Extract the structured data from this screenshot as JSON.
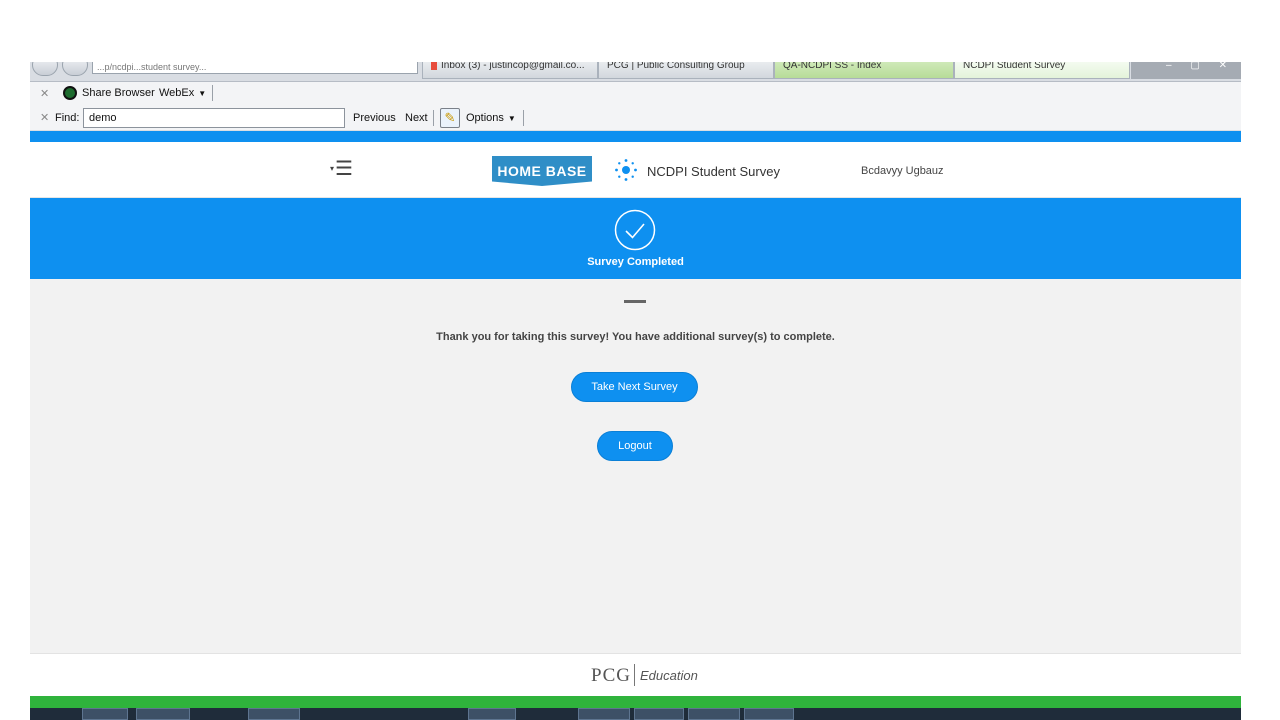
{
  "browser": {
    "url_fragment": "...p/ncdpi...student survey...",
    "tabs": [
      {
        "label": "Inbox (3) - justincop@gmail.co..."
      },
      {
        "label": "PCG | Public Consulting Group"
      },
      {
        "label": "QA-NCDPI SS - Index"
      },
      {
        "label": "NCDPI Student Survey"
      }
    ],
    "window_controls": "– ▢ ✕"
  },
  "toolbar": {
    "close_glyph": "✕",
    "share_browser_label": "Share Browser",
    "webex_label": "WebEx",
    "dropdown_caret": "▼"
  },
  "findbar": {
    "find_label": "Find:",
    "find_value": "demo",
    "previous_label": "Previous",
    "next_label": "Next",
    "options_label": "Options",
    "options_icon_glyph": "✎"
  },
  "header": {
    "menu_glyph": "☰",
    "menu_caret": "▾",
    "logo_text": "HOME BASE",
    "app_title": "NCDPI Student Survey",
    "user_name": "Bcdavyy Ugbauz"
  },
  "banner": {
    "label": "Survey Completed"
  },
  "main": {
    "message": "Thank you for taking this survey! You have additional survey(s) to complete.",
    "next_survey_button": "Take Next Survey",
    "logout_button": "Logout"
  },
  "footer": {
    "pcg_text": "PCG",
    "education_text": "Education"
  },
  "colors": {
    "accent_blue": "#0e90f0",
    "logo_blue": "#2f8ec7",
    "footer_green": "#2fb33c",
    "content_bg": "#f2f2f2"
  },
  "icons": {
    "sun": "sun-icon",
    "check": "check-circle-icon",
    "menu": "hamburger-menu-icon",
    "globe": "globe-icon"
  }
}
